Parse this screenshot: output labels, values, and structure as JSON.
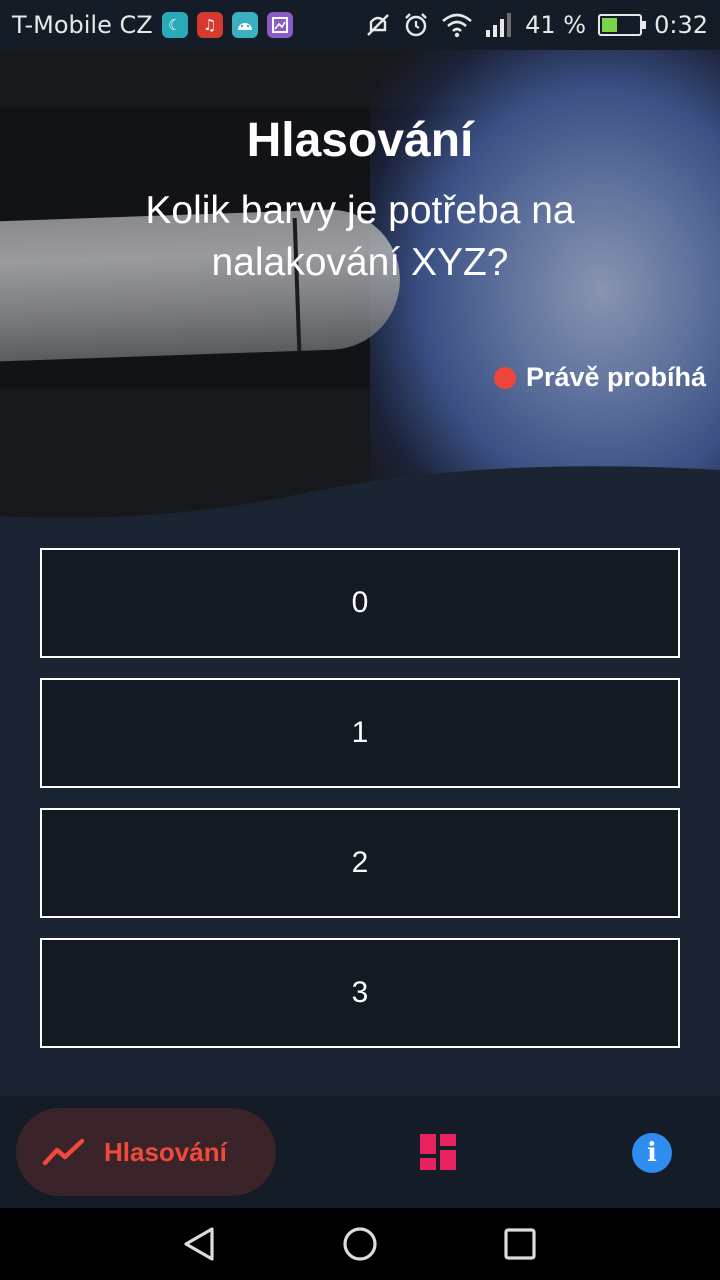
{
  "status_bar": {
    "carrier": "T-Mobile CZ",
    "battery_percent": "41 %",
    "battery_level": 0.41,
    "time": "0:32",
    "icons": [
      "moon-notification-icon",
      "music-notification-icon",
      "android-notification-icon",
      "gallery-notification-icon",
      "mute-icon",
      "alarm-icon",
      "wifi-icon",
      "signal-icon",
      "battery-icon"
    ]
  },
  "hero": {
    "title": "Hlasování",
    "question": "Kolik barvy je potřeba na nalakování XYZ?",
    "status": "Právě probíhá",
    "status_color": "#f0463a"
  },
  "options": [
    {
      "label": "0"
    },
    {
      "label": "1"
    },
    {
      "label": "2"
    },
    {
      "label": "3"
    }
  ],
  "bottom_nav": {
    "active_label": "Hlasování",
    "accent": "#ef4a3b",
    "items": [
      "trend-icon",
      "dashboard-icon",
      "info-icon"
    ],
    "info_glyph": "i"
  },
  "colors": {
    "background": "#1a2433",
    "option_bg": "#141a24",
    "dashboard_icon": "#e8215f",
    "info_icon": "#2f8df0"
  }
}
